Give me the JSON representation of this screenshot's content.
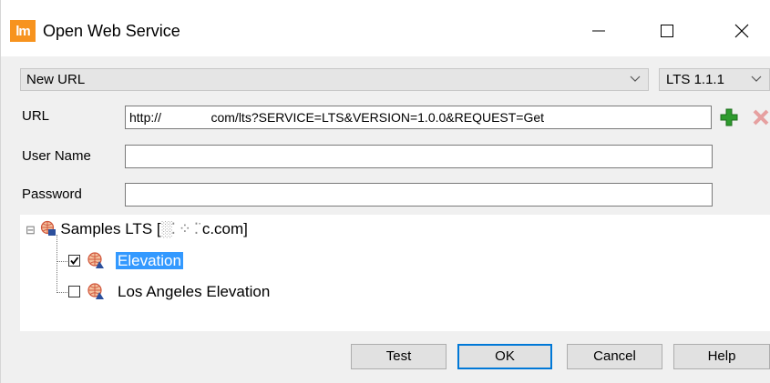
{
  "window": {
    "app_icon_text": "lm",
    "title": "Open Web Service",
    "minimize_glyph": "—",
    "maximize_glyph": "☐",
    "close_glyph": "✕"
  },
  "connection": {
    "url_preset": "New URL",
    "version": "LTS 1.1.1"
  },
  "form": {
    "url_label": "URL",
    "url_value": "http://              com/lts?SERVICE=LTS&VERSION=1.0.0&REQUEST=Get",
    "username_label": "User Name",
    "username_value": "",
    "password_label": "Password",
    "password_value": ""
  },
  "tree": {
    "root_toggle": "⊟",
    "root_label": "Samples LTS [",
    "root_label_end": "c.com]",
    "items": [
      {
        "label": "Elevation",
        "checked": true,
        "selected": true
      },
      {
        "label": "Los Angeles Elevation",
        "checked": false,
        "selected": false
      }
    ]
  },
  "buttons": {
    "test": "Test",
    "ok": "OK",
    "cancel": "Cancel",
    "help": "Help"
  },
  "colors": {
    "accent": "#0078d7",
    "selection": "#3399ff",
    "app_icon": "#f7931e",
    "add_icon": "#2e9b2e",
    "delete_icon": "#d9534f"
  },
  "icons": {
    "add": "plus-icon",
    "delete": "delete-x-icon",
    "service": "globe-service-icon",
    "layer": "layer-globe-icon"
  }
}
